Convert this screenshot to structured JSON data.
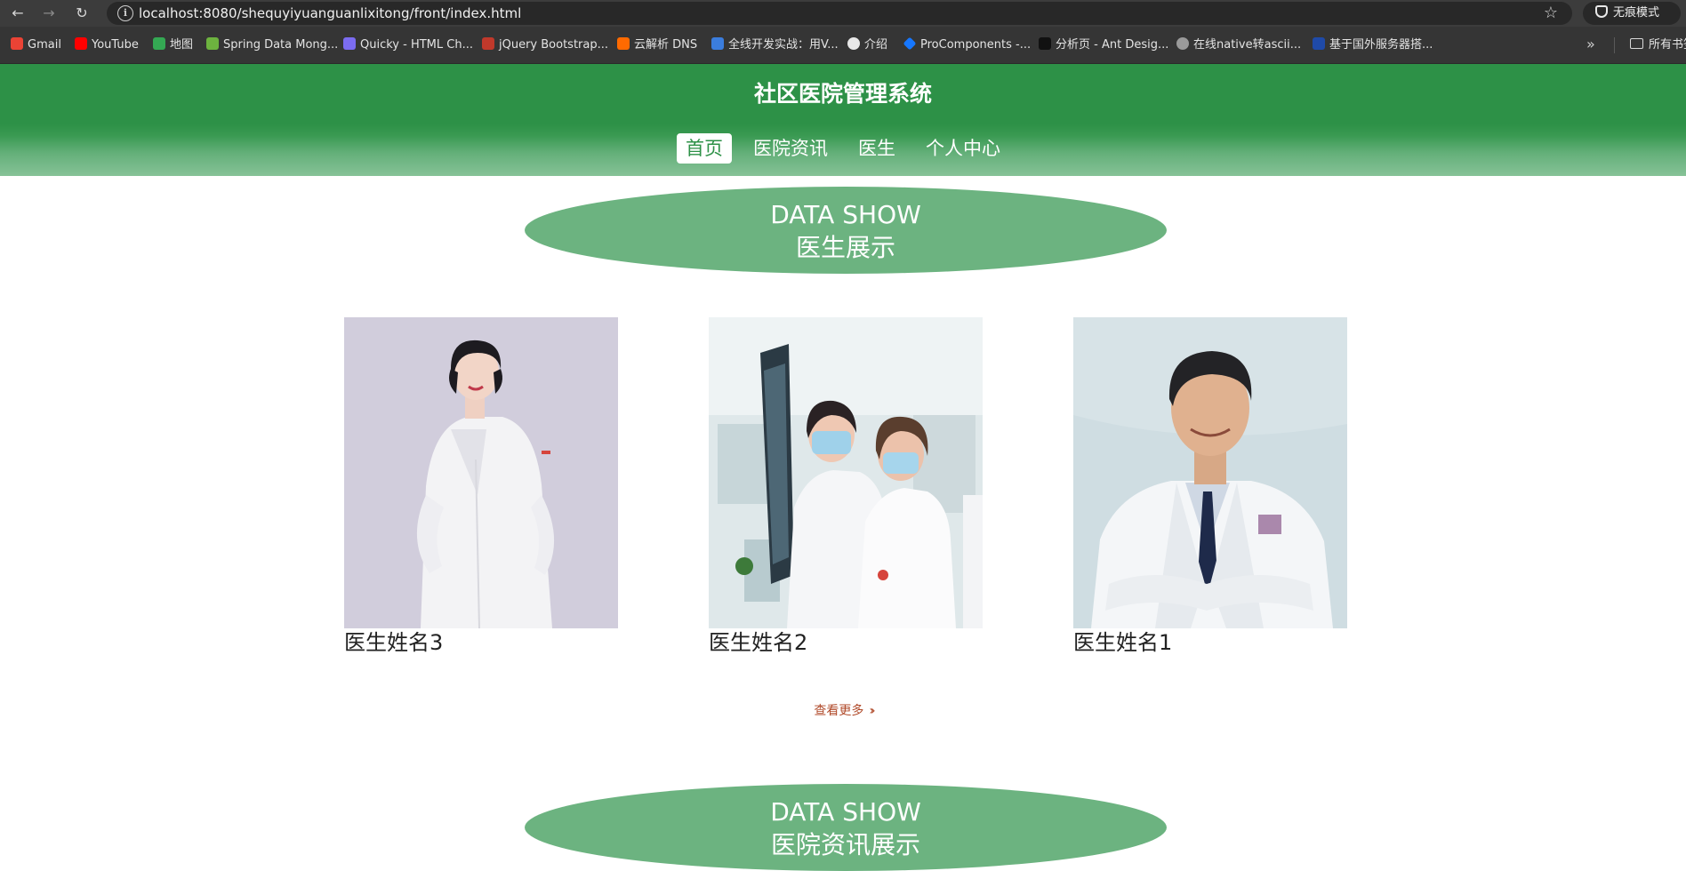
{
  "browser": {
    "url": "localhost:8080/shequyiyuanguanlixitong/front/index.html",
    "incognito_label": "无痕模式",
    "bookmarks": [
      {
        "label": "Gmail",
        "color": "#ea4335"
      },
      {
        "label": "YouTube",
        "color": "#ff0000"
      },
      {
        "label": "地图",
        "color": "#34a853"
      },
      {
        "label": "Spring Data Mong...",
        "color": "#6db33f"
      },
      {
        "label": "Quicky - HTML Ch...",
        "color": "#7b6cf0"
      },
      {
        "label": "jQuery Bootstrap...",
        "color": "#c0392b"
      },
      {
        "label": "云解析 DNS",
        "color": "#ff6a00"
      },
      {
        "label": "全线开发实战：用V...",
        "color": "#3b7ddd"
      },
      {
        "label": "介绍",
        "color": "#e8e8e8"
      },
      {
        "label": "ProComponents -...",
        "color": "#1677ff"
      },
      {
        "label": "分析页 - Ant Desig...",
        "color": "#111111"
      },
      {
        "label": "在线native转ascii...",
        "color": "#9a9a9a"
      },
      {
        "label": "基于国外服务器搭...",
        "color": "#1f4aa8"
      }
    ],
    "all_bookmarks_label": "所有书签"
  },
  "header": {
    "title": "社区医院管理系统",
    "nav": [
      {
        "label": "首页",
        "active": true
      },
      {
        "label": "医院资讯",
        "active": false
      },
      {
        "label": "医生",
        "active": false
      },
      {
        "label": "个人中心",
        "active": false
      }
    ]
  },
  "doctor_section": {
    "banner_en": "DATA SHOW",
    "banner_cn": "医生展示",
    "doctors": [
      {
        "name": "医生姓名3"
      },
      {
        "name": "医生姓名2"
      },
      {
        "name": "医生姓名1"
      }
    ],
    "more_label": "查看更多"
  },
  "news_section": {
    "banner_en": "DATA SHOW",
    "banner_cn": "医院资讯展示"
  },
  "colors": {
    "header_green": "#2d9147",
    "banner_green": "#6cb380",
    "more_link": "#b04a2a"
  }
}
